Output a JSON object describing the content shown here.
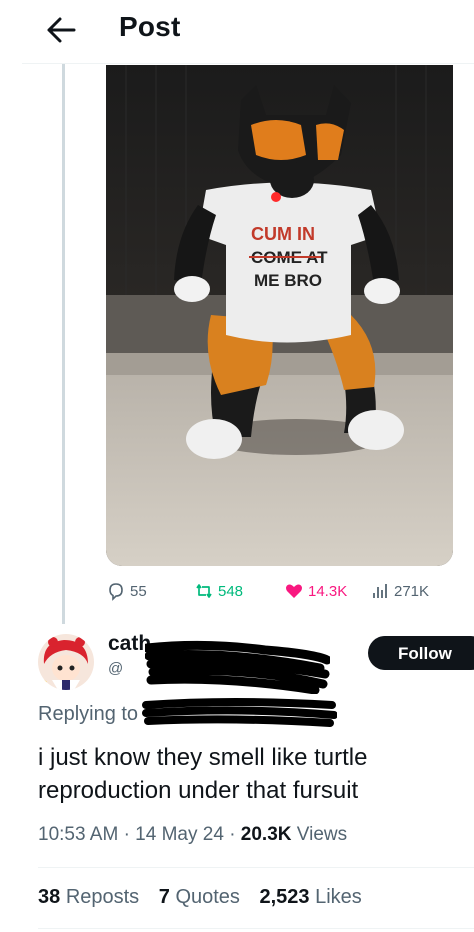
{
  "header": {
    "title": "Post"
  },
  "post": {
    "image_alt": "Person in a black and orange fursuit wearing a white T-shirt",
    "shirt_lines": [
      "CUM IN",
      "COME AT",
      "ME BRO"
    ],
    "metrics": {
      "replies": "55",
      "reposts": "548",
      "likes": "14.3K",
      "views": "271K"
    }
  },
  "reply": {
    "name": "cath",
    "follow_label": "Follow",
    "replying_to": "Replying to",
    "text": "i just know they smell like turtle reproduction under that fursuit",
    "time": "10:53 AM",
    "dot": "·",
    "date": "14 May 24",
    "views_count": "20.3K",
    "views_label": "Views",
    "reposts_count": "38",
    "reposts_label": "Reposts",
    "quotes_count": "7",
    "quotes_label": "Quotes",
    "likes_count": "2,523",
    "likes_label": "Likes"
  },
  "colors": {
    "accent_like": "#f91880",
    "accent_repost": "#00ba7c",
    "muted": "#536471"
  },
  "icons": [
    "back-arrow-icon",
    "reply-icon",
    "repost-icon",
    "like-icon",
    "views-icon"
  ]
}
